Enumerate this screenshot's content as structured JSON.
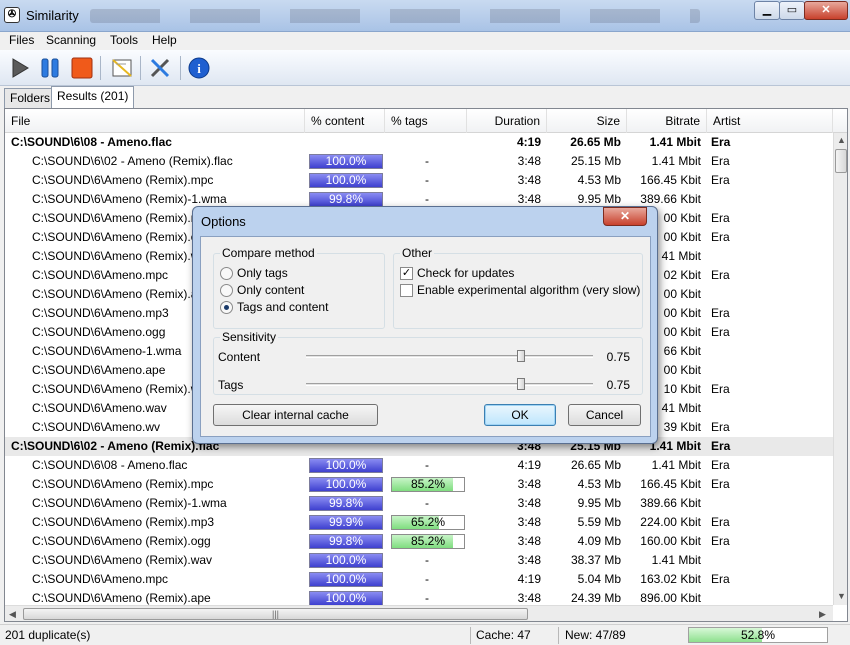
{
  "window": {
    "title": "Similarity",
    "icon": "app-icon"
  },
  "menu": [
    "Files",
    "Scanning",
    "Tools",
    "Help"
  ],
  "toolbar": [
    "play-icon",
    "pause-icon",
    "stop-icon",
    "report-icon",
    "tools-icon",
    "info-icon"
  ],
  "tabs": [
    {
      "label": "Folders",
      "active": false
    },
    {
      "label": "Results (201)",
      "active": true
    }
  ],
  "columns": [
    "File",
    "% content",
    "% tags",
    "Duration",
    "Size",
    "Bitrate",
    "Artist"
  ],
  "rows": [
    {
      "type": "group",
      "file": "C:\\SOUND\\6\\08 - Ameno.flac",
      "content": "",
      "tags": "",
      "duration": "4:19",
      "size": "26.65 Mb",
      "bitrate": "1.41 Mbit",
      "artist": "Era"
    },
    {
      "type": "item",
      "file": "C:\\SOUND\\6\\02 - Ameno (Remix).flac",
      "content": "100.0%",
      "tags": "-",
      "duration": "3:48",
      "size": "25.15 Mb",
      "bitrate": "1.41 Mbit",
      "artist": "Era"
    },
    {
      "type": "item",
      "file": "C:\\SOUND\\6\\Ameno (Remix).mpc",
      "content": "100.0%",
      "tags": "-",
      "duration": "3:48",
      "size": "4.53 Mb",
      "bitrate": "166.45 Kbit",
      "artist": "Era"
    },
    {
      "type": "item",
      "file": "C:\\SOUND\\6\\Ameno (Remix)-1.wma",
      "content": "99.8%",
      "tags": "-",
      "duration": "3:48",
      "size": "9.95 Mb",
      "bitrate": "389.66 Kbit",
      "artist": ""
    },
    {
      "type": "item",
      "file": "C:\\SOUND\\6\\Ameno (Remix).m",
      "content": "",
      "tags": "",
      "duration": "",
      "size": "",
      "bitrate": "00 Kbit",
      "artist": "Era"
    },
    {
      "type": "item",
      "file": "C:\\SOUND\\6\\Ameno (Remix).o",
      "content": "",
      "tags": "",
      "duration": "",
      "size": "",
      "bitrate": "00 Kbit",
      "artist": "Era"
    },
    {
      "type": "item",
      "file": "C:\\SOUND\\6\\Ameno (Remix).w",
      "content": "",
      "tags": "",
      "duration": "",
      "size": "",
      "bitrate": "41 Mbit",
      "artist": ""
    },
    {
      "type": "item",
      "file": "C:\\SOUND\\6\\Ameno.mpc",
      "content": "",
      "tags": "",
      "duration": "",
      "size": "",
      "bitrate": "02 Kbit",
      "artist": "Era"
    },
    {
      "type": "item",
      "file": "C:\\SOUND\\6\\Ameno (Remix).a",
      "content": "",
      "tags": "",
      "duration": "",
      "size": "",
      "bitrate": "00 Kbit",
      "artist": ""
    },
    {
      "type": "item",
      "file": "C:\\SOUND\\6\\Ameno.mp3",
      "content": "",
      "tags": "",
      "duration": "",
      "size": "",
      "bitrate": "00 Kbit",
      "artist": "Era"
    },
    {
      "type": "item",
      "file": "C:\\SOUND\\6\\Ameno.ogg",
      "content": "",
      "tags": "",
      "duration": "",
      "size": "",
      "bitrate": "00 Kbit",
      "artist": "Era"
    },
    {
      "type": "item",
      "file": "C:\\SOUND\\6\\Ameno-1.wma",
      "content": "",
      "tags": "",
      "duration": "",
      "size": "",
      "bitrate": "66 Kbit",
      "artist": ""
    },
    {
      "type": "item",
      "file": "C:\\SOUND\\6\\Ameno.ape",
      "content": "",
      "tags": "",
      "duration": "",
      "size": "",
      "bitrate": "00 Kbit",
      "artist": ""
    },
    {
      "type": "item",
      "file": "C:\\SOUND\\6\\Ameno (Remix).w",
      "content": "",
      "tags": "",
      "duration": "",
      "size": "",
      "bitrate": "10 Kbit",
      "artist": "Era"
    },
    {
      "type": "item",
      "file": "C:\\SOUND\\6\\Ameno.wav",
      "content": "",
      "tags": "",
      "duration": "",
      "size": "",
      "bitrate": "41 Mbit",
      "artist": ""
    },
    {
      "type": "item",
      "file": "C:\\SOUND\\6\\Ameno.wv",
      "content": "",
      "tags": "",
      "duration": "",
      "size": "",
      "bitrate": "39 Kbit",
      "artist": "Era"
    },
    {
      "type": "group",
      "file": "C:\\SOUND\\6\\02 - Ameno (Remix).flac",
      "content": "",
      "tags": "",
      "duration": "3:48",
      "size": "25.15 Mb",
      "bitrate": "1.41 Mbit",
      "artist": "Era"
    },
    {
      "type": "item",
      "file": "C:\\SOUND\\6\\08 - Ameno.flac",
      "content": "100.0%",
      "tags": "-",
      "duration": "4:19",
      "size": "26.65 Mb",
      "bitrate": "1.41 Mbit",
      "artist": "Era"
    },
    {
      "type": "item",
      "file": "C:\\SOUND\\6\\Ameno (Remix).mpc",
      "content": "100.0%",
      "tags": "85.2%",
      "duration": "3:48",
      "size": "4.53 Mb",
      "bitrate": "166.45 Kbit",
      "artist": "Era"
    },
    {
      "type": "item",
      "file": "C:\\SOUND\\6\\Ameno (Remix)-1.wma",
      "content": "99.8%",
      "tags": "-",
      "duration": "3:48",
      "size": "9.95 Mb",
      "bitrate": "389.66 Kbit",
      "artist": ""
    },
    {
      "type": "item",
      "file": "C:\\SOUND\\6\\Ameno (Remix).mp3",
      "content": "99.9%",
      "tags": "65.2%",
      "duration": "3:48",
      "size": "5.59 Mb",
      "bitrate": "224.00 Kbit",
      "artist": "Era"
    },
    {
      "type": "item",
      "file": "C:\\SOUND\\6\\Ameno (Remix).ogg",
      "content": "99.8%",
      "tags": "85.2%",
      "duration": "3:48",
      "size": "4.09 Mb",
      "bitrate": "160.00 Kbit",
      "artist": "Era"
    },
    {
      "type": "item",
      "file": "C:\\SOUND\\6\\Ameno (Remix).wav",
      "content": "100.0%",
      "tags": "-",
      "duration": "3:48",
      "size": "38.37 Mb",
      "bitrate": "1.41 Mbit",
      "artist": ""
    },
    {
      "type": "item",
      "file": "C:\\SOUND\\6\\Ameno.mpc",
      "content": "100.0%",
      "tags": "-",
      "duration": "4:19",
      "size": "5.04 Mb",
      "bitrate": "163.02 Kbit",
      "artist": "Era"
    },
    {
      "type": "item",
      "file": "C:\\SOUND\\6\\Ameno (Remix).ape",
      "content": "100.0%",
      "tags": "-",
      "duration": "3:48",
      "size": "24.39 Mb",
      "bitrate": "896.00 Kbit",
      "artist": ""
    }
  ],
  "status": {
    "duplicates": "201 duplicate(s)",
    "cache": "Cache: 47",
    "new": "New: 47/89",
    "progress_label": "52.8%",
    "progress": 0.528
  },
  "dialog": {
    "title": "Options",
    "compare": {
      "label": "Compare method",
      "options": [
        "Only tags",
        "Only content",
        "Tags and content"
      ],
      "selected": 2
    },
    "other": {
      "label": "Other",
      "check_updates": "Check for updates",
      "check_updates_on": true,
      "experimental": "Enable experimental algorithm (very slow)",
      "experimental_on": false
    },
    "sensitivity": {
      "label": "Sensitivity",
      "content_label": "Content",
      "content_value": "0.75",
      "content_level": 0.75,
      "tags_label": "Tags",
      "tags_value": "0.75",
      "tags_level": 0.75
    },
    "clear_cache": "Clear internal cache",
    "ok": "OK",
    "cancel": "Cancel"
  },
  "colors": {
    "content_bar": "#4446d6",
    "tags_bar": "#7fdd7f",
    "dialog_frame": "#bcd2ee"
  }
}
